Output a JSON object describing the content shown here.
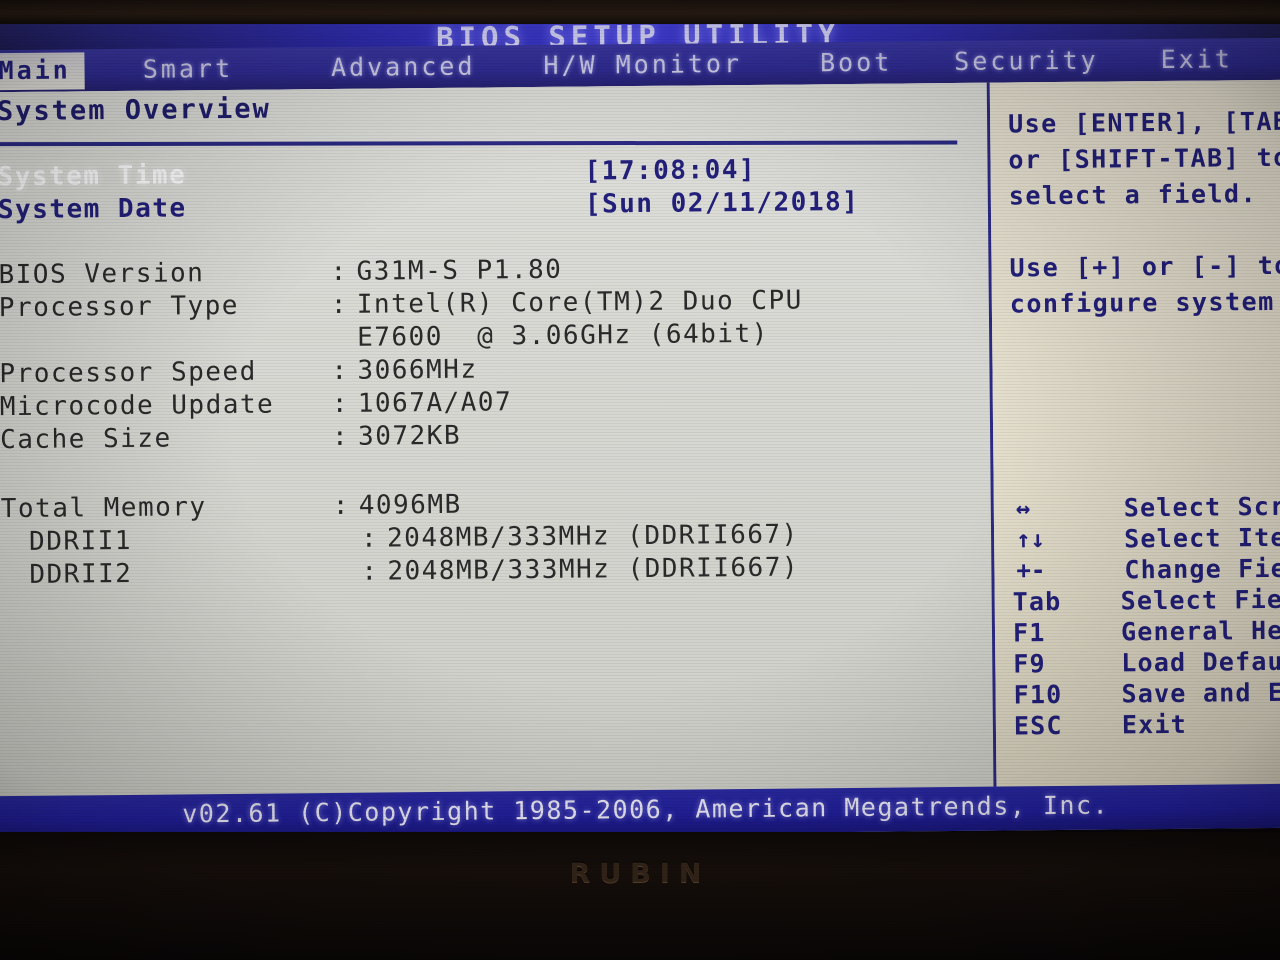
{
  "monitor": {
    "brand": "RUBIN"
  },
  "titlebar": {
    "title": "BIOS SETUP UTILITY"
  },
  "menu": {
    "tabs": [
      {
        "label": "Main",
        "active": true
      },
      {
        "label": "Smart",
        "active": false
      },
      {
        "label": "Advanced",
        "active": false
      },
      {
        "label": "H/W Monitor",
        "active": false
      },
      {
        "label": "Boot",
        "active": false
      },
      {
        "label": "Security",
        "active": false
      },
      {
        "label": "Exit",
        "active": false
      }
    ]
  },
  "main": {
    "section_title": "System Overview",
    "fields": [
      {
        "label": "System Time",
        "value": "[17:08:04]",
        "highlighted": true
      },
      {
        "label": "System Date",
        "value": "[Sun 02/11/2018]",
        "highlighted": false
      }
    ],
    "info": [
      {
        "key": "BIOS Version",
        "sep": ":",
        "value": "G31M-S P1.80"
      },
      {
        "key": "Processor Type",
        "sep": ":",
        "value": "Intel(R) Core(TM)2 Duo CPU"
      },
      {
        "key": "",
        "sep": "",
        "value": "E7600  @ 3.06GHz (64bit)"
      },
      {
        "key": "Processor Speed",
        "sep": ":",
        "value": "3066MHz"
      },
      {
        "key": "Microcode Update",
        "sep": ":",
        "value": "1067A/A07"
      },
      {
        "key": "Cache Size",
        "sep": ":",
        "value": "3072KB"
      }
    ],
    "memory": [
      {
        "key": "Total Memory",
        "sep": ":",
        "value": "4096MB",
        "indent": false
      },
      {
        "key": "DDRII1",
        "sep": ":",
        "value": "2048MB/333MHz (DDRII667)",
        "indent": true
      },
      {
        "key": "DDRII2",
        "sep": ":",
        "value": "2048MB/333MHz (DDRII667)",
        "indent": true
      }
    ]
  },
  "help": {
    "lines": [
      "Use [ENTER], [TAB]",
      "or [SHIFT-TAB] to",
      "select a field.",
      "",
      "Use [+] or [-] to",
      "configure system"
    ],
    "legend": [
      {
        "key": "↔",
        "desc": "Select Screen"
      },
      {
        "key": "↑↓",
        "desc": "Select Item"
      },
      {
        "key": "+-",
        "desc": "Change Field"
      },
      {
        "key": "Tab",
        "desc": "Select Field"
      },
      {
        "key": "F1",
        "desc": "General Help"
      },
      {
        "key": "F9",
        "desc": "Load Defaults"
      },
      {
        "key": "F10",
        "desc": "Save and Exit"
      },
      {
        "key": "ESC",
        "desc": "Exit"
      }
    ]
  },
  "footer": {
    "text": "v02.61 (C)Copyright 1985-2006, American Megatrends, Inc."
  },
  "colors": {
    "title_band": "#3f3ad6",
    "menu_bar": "#2f2b93",
    "active_tab_bg": "#e8e6de",
    "bios_blue": "#23207c",
    "screen_bg": "#d8d8d3",
    "help_bg": "#e3ddcb",
    "footer_bg": "#2220a0"
  }
}
